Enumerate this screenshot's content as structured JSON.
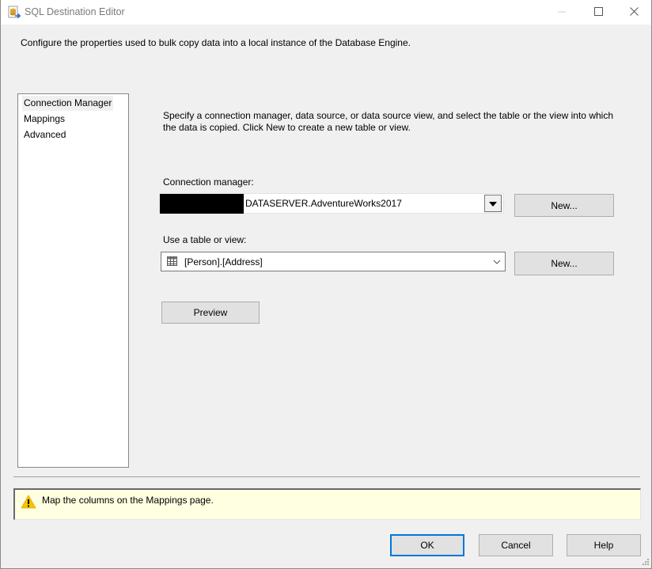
{
  "window": {
    "title": "SQL Destination Editor",
    "icons": {
      "app": "sql-destination-icon",
      "minimize": "minimize-icon",
      "maximize": "maximize-icon",
      "close": "close-icon"
    }
  },
  "description": "Configure the properties used to bulk copy data into a local instance of the Database Engine.",
  "nav": {
    "items": [
      {
        "label": "Connection Manager",
        "selected": true
      },
      {
        "label": "Mappings",
        "selected": false
      },
      {
        "label": "Advanced",
        "selected": false
      }
    ]
  },
  "main": {
    "instructions": "Specify a connection manager, data source, or data source view, and select the table or the view into which the data is copied. Click New to create a new table or view.",
    "connection_manager": {
      "label": "Connection manager:",
      "value": "DATASERVER.AdventureWorks2017",
      "redacted_prefix": true,
      "new_button": "New..."
    },
    "table_or_view": {
      "label": "Use a table or view:",
      "value": "[Person].[Address]",
      "icon": "table-icon",
      "new_button": "New..."
    },
    "preview_button": "Preview"
  },
  "status": {
    "icon": "warning-icon",
    "message": "Map the columns on the Mappings page."
  },
  "footer": {
    "ok": "OK",
    "cancel": "Cancel",
    "help": "Help"
  },
  "colors": {
    "warning_bg": "#ffffe1",
    "default_button_border": "#0078d7",
    "warning_icon": "#f5c400"
  }
}
